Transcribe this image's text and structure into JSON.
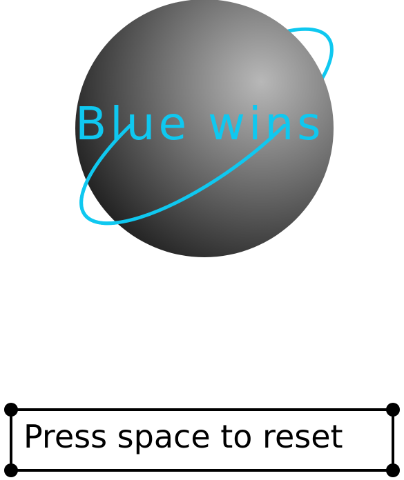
{
  "game": {
    "status_message": "Blue wins",
    "reset_prompt": "Press space to reset"
  },
  "icons": {
    "planet": "planet-with-ring-icon"
  },
  "colors": {
    "winner_accent": "#0fc8f0",
    "planet_light": "#b4b4b4",
    "planet_dark": "#141414",
    "prompt_border": "#000000",
    "background": "#ffffff"
  }
}
